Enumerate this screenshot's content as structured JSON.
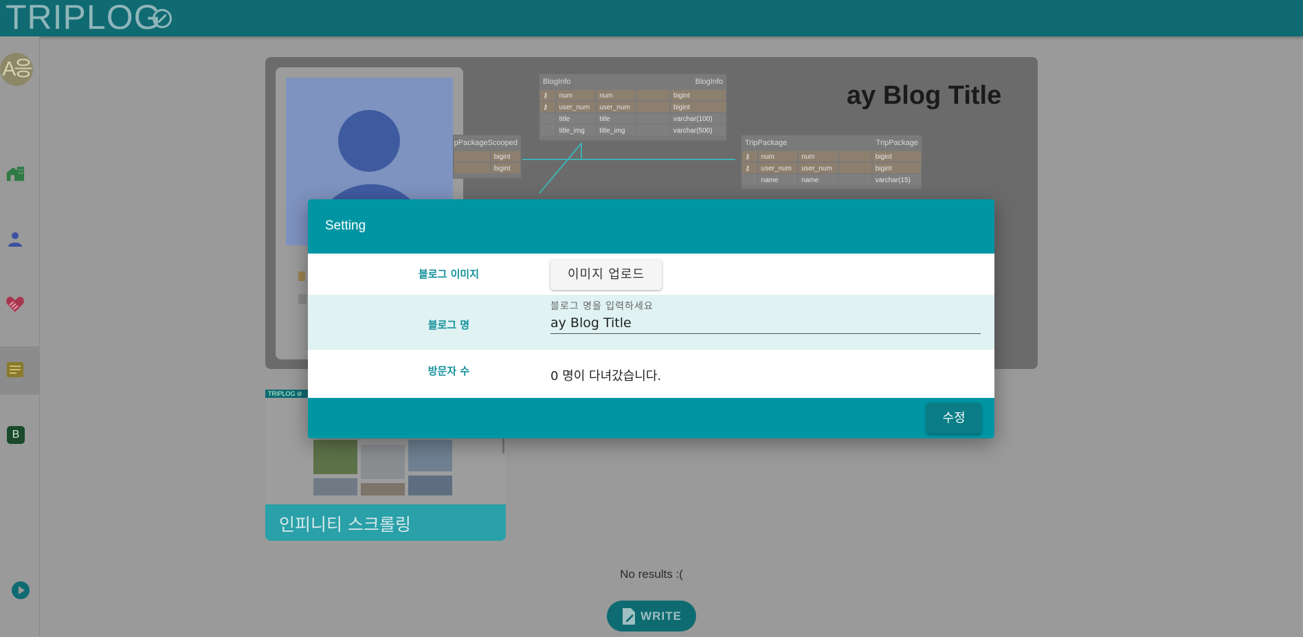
{
  "header": {
    "logo": "TRIPLOG"
  },
  "sidebar": {
    "avatar_text": "A응",
    "badge_b": "B"
  },
  "banner": {
    "title": "ay Blog Title",
    "erd": {
      "bloginfo": {
        "name_left": "BlogInfo",
        "name_right": "BlogInfo",
        "rows": [
          [
            "num",
            "num",
            "",
            "bigint"
          ],
          [
            "user_num",
            "user_num",
            "",
            "bigint"
          ],
          [
            "title",
            "title",
            "",
            "varchar(100)"
          ],
          [
            "title_img",
            "title_img",
            "",
            "varchar(500)"
          ]
        ]
      },
      "scooped": {
        "name": "pPackageScooped",
        "rows": [
          [
            "bigint"
          ],
          [
            "bigint"
          ]
        ]
      },
      "trippackage": {
        "name_left": "TripPackage",
        "name_right": "TripPackage",
        "rows": [
          [
            "num",
            "num",
            "",
            "bigint"
          ],
          [
            "user_num",
            "user_num",
            "",
            "bigint"
          ],
          [
            "name",
            "name",
            "",
            "varchar(15)"
          ]
        ]
      }
    }
  },
  "post": {
    "bar_text": "TRIPLOG ⊘",
    "title": "인피니티 스크롤링"
  },
  "no_results": "No results :(",
  "write_label": "WRITE",
  "modal": {
    "title": "Setting",
    "rows": {
      "image_label": "블로그 이미지",
      "upload_label": "이미지 업로드",
      "name_label": "블로그 명",
      "name_placeholder": "블로그 명을 입력하세요",
      "name_value": "ay Blog Title",
      "visitor_label": "방문자 수",
      "visitor_text": "0 명이 다녀갔습니다."
    },
    "save_label": "수정"
  }
}
